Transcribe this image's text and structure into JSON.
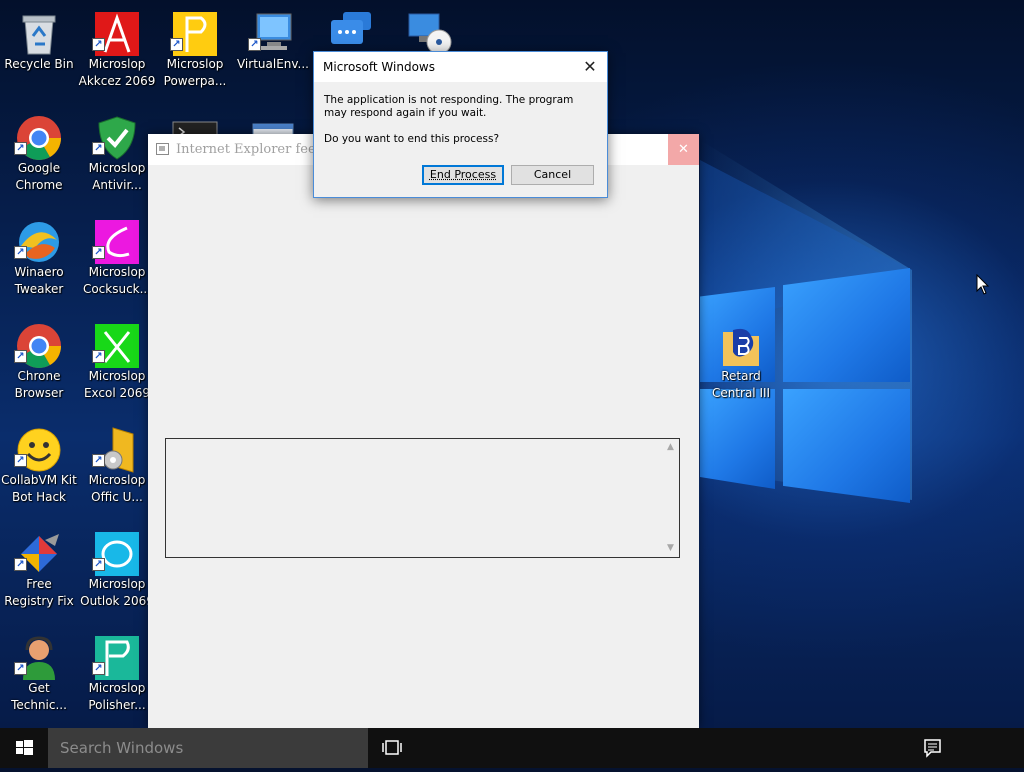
{
  "desktop": {
    "icons": [
      {
        "label": "Recycle Bin"
      },
      {
        "label": "Microslop\nAkkcez 2069"
      },
      {
        "label": "Microslop\nPowerpa..."
      },
      {
        "label": "VirtualEnv..."
      },
      {
        "label": "Google\nChrome"
      },
      {
        "label": "Microslop\nAntivir..."
      },
      {
        "label": "Winaero\nTweaker"
      },
      {
        "label": "Microslop\nCocksuck..."
      },
      {
        "label": "Chrone\nBrowser"
      },
      {
        "label": "Microslop\nExcol 2069"
      },
      {
        "label": "CollabVM Kit\nBot Hack"
      },
      {
        "label": "Microslop\nOffic U..."
      },
      {
        "label": "Free\nRegistry Fix"
      },
      {
        "label": "Microslop\nOutlok 2069"
      },
      {
        "label": "Get\nTechnic..."
      },
      {
        "label": "Microslop\nPolisher..."
      },
      {
        "label": "Retard\nCentral III"
      }
    ]
  },
  "ie_window": {
    "title": "Internet Explorer feedb"
  },
  "dialog": {
    "title": "Microsoft Windows",
    "message": "The application is not responding. The program may respond again if you wait.",
    "question": "Do you want to end this process?",
    "end_process_label": "End Process",
    "cancel_label": "Cancel"
  },
  "taskbar": {
    "search_placeholder": "Search Windows"
  },
  "colors": {
    "accent": "#0078d7",
    "taskbar": "#101010",
    "search_box": "#3b3b3b"
  }
}
